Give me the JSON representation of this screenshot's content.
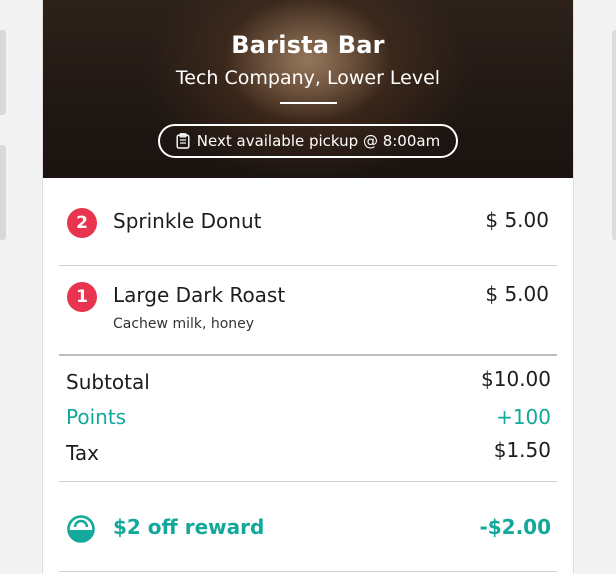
{
  "hero": {
    "title": "Barista Bar",
    "location": "Tech Company, Lower Level",
    "pickup": "Next available pickup @ 8:00am"
  },
  "items": [
    {
      "qty": "2",
      "name": "Sprinkle Donut",
      "price": "$ 5.00",
      "note": ""
    },
    {
      "qty": "1",
      "name": "Large Dark Roast",
      "price": "$ 5.00",
      "note": "Cachew milk, honey"
    }
  ],
  "totals": {
    "subtotal_label": "Subtotal",
    "subtotal_value": "$10.00",
    "points_label": "Points",
    "points_value": "+100",
    "tax_label": "Tax",
    "tax_value": "$1.50"
  },
  "reward": {
    "label": "$2 off reward",
    "value": "-$2.00",
    "icon": "reward-icon"
  },
  "colors": {
    "accent_teal": "#12a89a",
    "badge_red": "#e8344e"
  }
}
